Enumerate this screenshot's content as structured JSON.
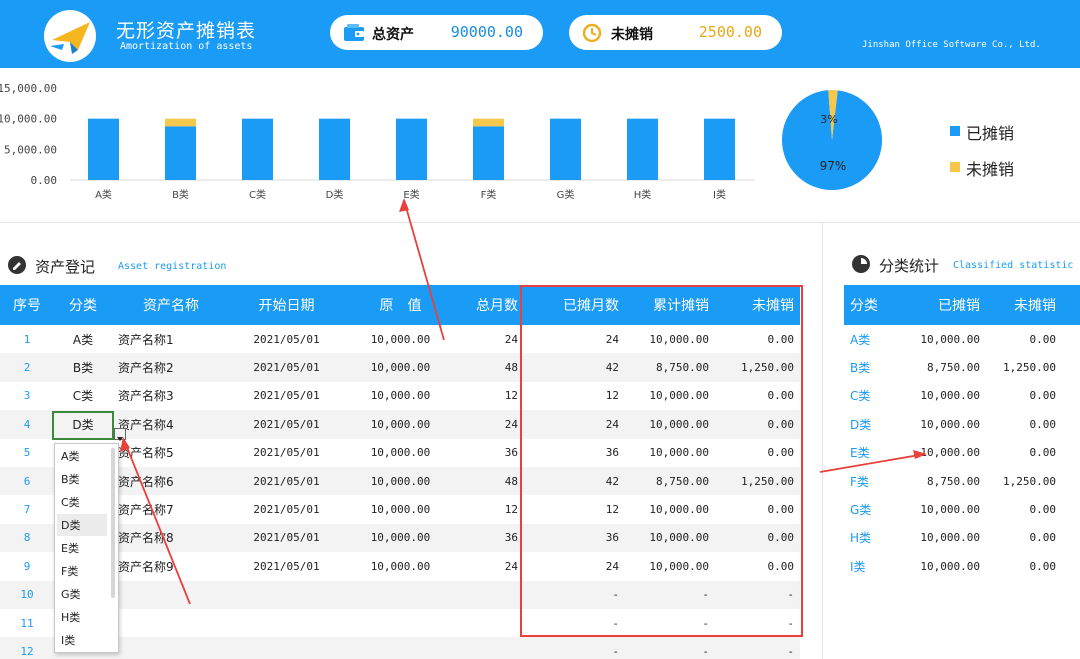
{
  "header": {
    "title": "无形资产摊销表",
    "subtitle": "Amortization of assets",
    "total_label": "总资产",
    "total_value": "90000.00",
    "unamort_label": "未摊销",
    "unamort_value": "2500.00",
    "company": "Jinshan Office Software Co., Ltd.",
    "colors": {
      "primary": "#1a9bf5",
      "accent": "#f5c84c"
    }
  },
  "chart_data": [
    {
      "type": "bar",
      "categories": [
        "A类",
        "B类",
        "C类",
        "D类",
        "E类",
        "F类",
        "G类",
        "H类",
        "I类"
      ],
      "series": [
        {
          "name": "已摊销",
          "values": [
            10000,
            8750,
            10000,
            10000,
            10000,
            8750,
            10000,
            10000,
            10000
          ],
          "color": "#1a9bf5"
        },
        {
          "name": "未摊销",
          "values": [
            0,
            1250,
            0,
            0,
            0,
            1250,
            0,
            0,
            0
          ],
          "color": "#f5c84c"
        }
      ],
      "stacked": true,
      "yticks": [
        "0.00",
        "5,000.00",
        "10,000.00",
        "15,000.00"
      ],
      "ylim": [
        0,
        15000
      ],
      "grid": false
    },
    {
      "type": "pie",
      "labels": [
        "已摊销",
        "未摊销"
      ],
      "values": [
        97,
        3
      ],
      "display": [
        "97%",
        "3%"
      ],
      "colors": [
        "#1a9bf5",
        "#f5c84c"
      ],
      "legend": "right"
    }
  ],
  "legend": [
    {
      "label": "已摊销",
      "color": "#1a9bf5"
    },
    {
      "label": "未摊销",
      "color": "#f5c84c"
    }
  ],
  "registration": {
    "title": "资产登记",
    "subtitle": "Asset registration",
    "headers": [
      "序号",
      "分类",
      "资产名称",
      "开始日期",
      "原　值",
      "总月数",
      "已摊月数",
      "累计摊销",
      "未摊销"
    ],
    "rows": [
      [
        "1",
        "A类",
        "资产名称1",
        "2021/05/01",
        "10,000.00",
        "24",
        "24",
        "10,000.00",
        "0.00"
      ],
      [
        "2",
        "B类",
        "资产名称2",
        "2021/05/01",
        "10,000.00",
        "48",
        "42",
        "8,750.00",
        "1,250.00"
      ],
      [
        "3",
        "C类",
        "资产名称3",
        "2021/05/01",
        "10,000.00",
        "12",
        "12",
        "10,000.00",
        "0.00"
      ],
      [
        "4",
        "D类",
        "资产名称4",
        "2021/05/01",
        "10,000.00",
        "24",
        "24",
        "10,000.00",
        "0.00"
      ],
      [
        "5",
        "",
        "资产名称5",
        "2021/05/01",
        "10,000.00",
        "36",
        "36",
        "10,000.00",
        "0.00"
      ],
      [
        "6",
        "",
        "资产名称6",
        "2021/05/01",
        "10,000.00",
        "48",
        "42",
        "8,750.00",
        "1,250.00"
      ],
      [
        "7",
        "",
        "资产名称7",
        "2021/05/01",
        "10,000.00",
        "12",
        "12",
        "10,000.00",
        "0.00"
      ],
      [
        "8",
        "",
        "资产名称8",
        "2021/05/01",
        "10,000.00",
        "36",
        "36",
        "10,000.00",
        "0.00"
      ],
      [
        "9",
        "",
        "资产名称9",
        "2021/05/01",
        "10,000.00",
        "24",
        "24",
        "10,000.00",
        "0.00"
      ],
      [
        "10",
        "",
        "",
        "",
        "",
        "",
        "-",
        "-",
        "-"
      ],
      [
        "11",
        "",
        "",
        "",
        "",
        "",
        "-",
        "-",
        "-"
      ],
      [
        "12",
        "",
        "",
        "",
        "",
        "",
        "-",
        "-",
        "-"
      ]
    ]
  },
  "dropdown": {
    "options": [
      "A类",
      "B类",
      "C类",
      "D类",
      "E类",
      "F类",
      "G类",
      "H类",
      "I类"
    ],
    "selected": "D类"
  },
  "classified": {
    "title": "分类统计",
    "subtitle": "Classified statistic",
    "headers": [
      "分类",
      "已摊销",
      "未摊销"
    ],
    "rows": [
      [
        "A类",
        "10,000.00",
        "0.00"
      ],
      [
        "B类",
        "8,750.00",
        "1,250.00"
      ],
      [
        "C类",
        "10,000.00",
        "0.00"
      ],
      [
        "D类",
        "10,000.00",
        "0.00"
      ],
      [
        "E类",
        "10,000.00",
        "0.00"
      ],
      [
        "F类",
        "8,750.00",
        "1,250.00"
      ],
      [
        "G类",
        "10,000.00",
        "0.00"
      ],
      [
        "H类",
        "10,000.00",
        "0.00"
      ],
      [
        "I类",
        "10,000.00",
        "0.00"
      ]
    ]
  }
}
